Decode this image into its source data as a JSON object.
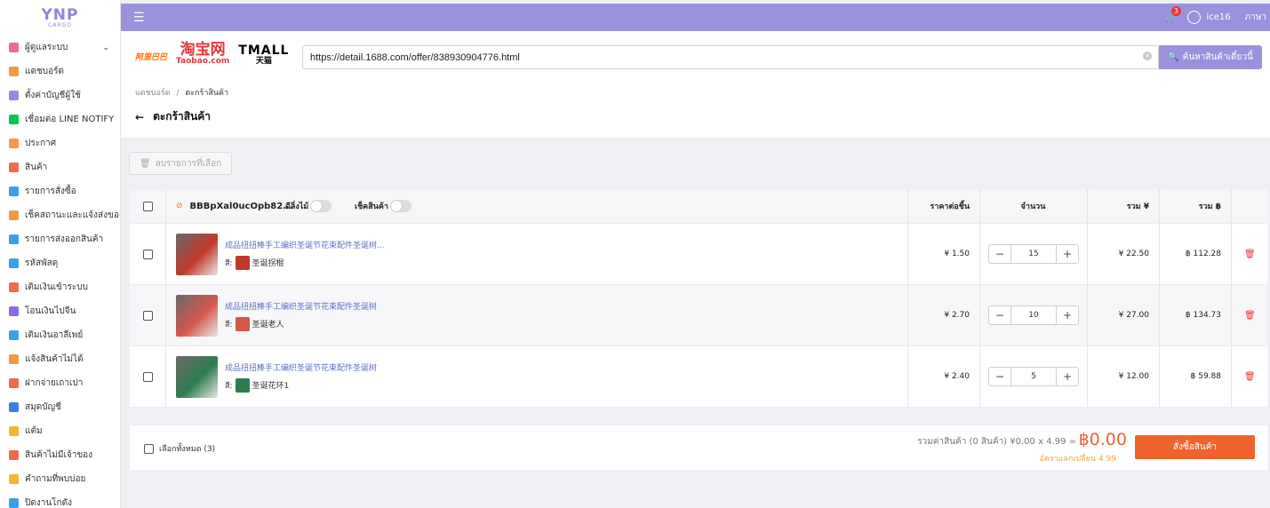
{
  "logo": {
    "brand": "YNP",
    "sub": "CARGO"
  },
  "sidebar": {
    "items": [
      {
        "label": "ผู้ดูแลระบบ",
        "icon": "grid-icon",
        "color": "#f06a8a",
        "has_chevron": true
      },
      {
        "label": "แดชบอร์ด",
        "icon": "chart-icon",
        "color": "#f2994a"
      },
      {
        "label": "ตั้งค่าบัญชีผู้ใช้",
        "icon": "user-cog-icon",
        "color": "#9b86e6"
      },
      {
        "label": "เชื่อมต่อ LINE NOTIFY",
        "icon": "line-icon",
        "color": "#06c755"
      },
      {
        "label": "ประกาศ",
        "icon": "megaphone-icon",
        "color": "#f2994a"
      },
      {
        "label": "สินค้า",
        "icon": "box-icon",
        "color": "#f06a50"
      },
      {
        "label": "รายการสั่งซื้อ",
        "icon": "cart-icon",
        "color": "#3aa0e8"
      },
      {
        "label": "เช็คสถานะและแจ้งส่งของ",
        "icon": "truck-icon",
        "color": "#f2994a"
      },
      {
        "label": "รายการส่งออกสินค้า",
        "icon": "export-icon",
        "color": "#3aa0e8"
      },
      {
        "label": "รหัสพัสดุ",
        "icon": "cube-icon",
        "color": "#3aa0e8"
      },
      {
        "label": "เติมเงินเข้าระบบ",
        "icon": "piggy-icon",
        "color": "#f06a50"
      },
      {
        "label": "โอนเงินไปจีน",
        "icon": "transfer-icon",
        "color": "#8a6ae6"
      },
      {
        "label": "เติมเงินอาลีเพย์",
        "icon": "alipay-icon",
        "color": "#3aa0e8"
      },
      {
        "label": "แจ้งสินค้าไม่ได้",
        "icon": "report-icon",
        "color": "#f2994a"
      },
      {
        "label": "ฝากจ่ายเถาเปา",
        "icon": "taobao-icon",
        "color": "#f06a50"
      },
      {
        "label": "สมุดบัญชี",
        "icon": "book-icon",
        "color": "#3a7ee8"
      },
      {
        "label": "แต้ม",
        "icon": "medal-icon",
        "color": "#f2b630"
      },
      {
        "label": "สินค้าไม่มีเจ้าของ",
        "icon": "question-box-icon",
        "color": "#f06a50"
      },
      {
        "label": "คำถามที่พบบ่อย",
        "icon": "faq-icon",
        "color": "#f2b630"
      },
      {
        "label": "ปิดงานโกดัง",
        "icon": "calendar-icon",
        "color": "#3aa0e8"
      }
    ]
  },
  "topbar": {
    "cart_count": "3",
    "username": "ice16",
    "language": "ภาษา"
  },
  "platforms": {
    "p1688": "阿里巴巴",
    "taobao_cn": "淘宝网",
    "taobao_en": "Taobao.com",
    "tmall_en": "TMALL",
    "tmall_cn": "天猫"
  },
  "search": {
    "url": "https://detail.1688.com/offer/838930904776.html",
    "button_label": "ค้นหาสินค้าเดี๋ยวนี้"
  },
  "breadcrumb": {
    "home": "แดชบอร์ด",
    "sep": "/",
    "current": "ตะกร้าสินค้า"
  },
  "page_title": "ตะกร้าสินค้า",
  "delete_selected_label": "ลบรายการที่เลือก",
  "table": {
    "shop_name": "BBBpXal0ucOpb82...",
    "toggle_delay_label": "ดีลิ่งไม้",
    "toggle_check_label": "เช็คสินค้า",
    "headers": {
      "unit_price": "ราคาต่อชิ้น",
      "quantity": "จำนวน",
      "total_cny": "รวม ¥",
      "total_thb": "รวม ฿"
    },
    "rows": [
      {
        "name": "成品扭扭棒手工编织圣诞节花束配件圣诞树...",
        "variant_label": "สี:",
        "variant": "圣诞拐棍",
        "price": "¥ 1.50",
        "qty": "15",
        "total_cny": "¥ 22.50",
        "total_thb": "฿ 112.28",
        "color": "#c0392b"
      },
      {
        "name": "成品扭扭棒手工编织圣诞节花束配件圣诞树",
        "variant_label": "สี:",
        "variant": "圣诞老人",
        "price": "¥ 2.70",
        "qty": "10",
        "total_cny": "¥ 27.00",
        "total_thb": "฿ 134.73",
        "color": "#d4574a"
      },
      {
        "name": "成品扭扭棒手工编织圣诞节花束配件圣诞树",
        "variant_label": "สี:",
        "variant": "圣诞花环1",
        "price": "¥ 2.40",
        "qty": "5",
        "total_cny": "¥ 12.00",
        "total_thb": "฿ 59.88",
        "color": "#2e7d4f"
      }
    ]
  },
  "summary": {
    "select_all_label": "เลือกทั้งหมด (3)",
    "total_text": "รวมค่าสินค้า (0 สินค้า) ¥0.00 x 4.99 =",
    "total_value": "฿0.00",
    "rate_text": "อัตราแลกเปลี่ยน 4.99",
    "order_button": "สั่งซื้อสินค้า"
  }
}
